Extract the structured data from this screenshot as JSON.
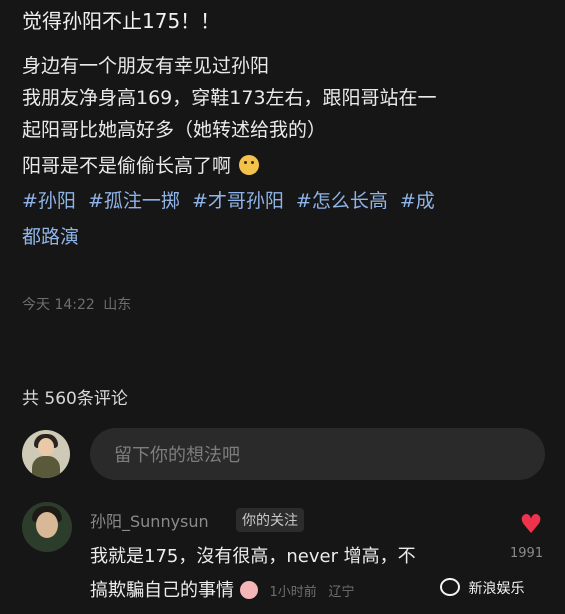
{
  "post": {
    "title": "觉得孙阳不止175！！",
    "lines": [
      "身边有一个朋友有幸见过孙阳",
      "我朋友净身高169，穿鞋173左右，跟阳哥站在一",
      "起阳哥比她高好多（她转述给我的）",
      "阳哥是不是偷偷长高了啊"
    ],
    "tags_line1": [
      "#孙阳",
      "#孤注一掷",
      "#才哥孙阳",
      "#怎么长高",
      "#成"
    ],
    "tags_line2": "都路演",
    "time": "今天 14:22",
    "location": "山东"
  },
  "comments": {
    "count_label": "共 560条评论",
    "input_placeholder": "留下你的想法吧",
    "items": [
      {
        "user": "孙阳_Sunnysun",
        "badge": "你的关注",
        "text_line1": "我就是175，沒有很高，never 增高，不",
        "text_line2": "搞欺騙自己的事情",
        "time": "1小时前",
        "location": "辽宁",
        "likes": "1991"
      }
    ]
  },
  "watermark": "新浪娱乐",
  "icons": {
    "like": "heart-icon",
    "emoji_post": "face-icon",
    "emoji_comment": "face-icon",
    "watermark_logo": "weibo-logo-icon"
  },
  "colors": {
    "background": "#161616",
    "hashtag": "#8fb4e8",
    "like": "#f0334d"
  }
}
